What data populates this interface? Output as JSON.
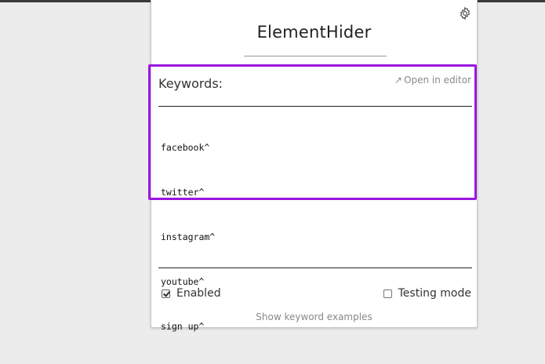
{
  "app": {
    "title": "ElementHider"
  },
  "icons": {
    "settings": "gear-icon",
    "open_editor": "arrow-up-right-icon"
  },
  "keywords": {
    "label": "Keywords:",
    "open_in_editor_label": "Open in editor",
    "lines": [
      "facebook^",
      "twitter^",
      "instagram^",
      "youtube^",
      "sign up^"
    ]
  },
  "options": {
    "enabled_label": "Enabled",
    "enabled_checked": true,
    "testing_label": "Testing mode",
    "testing_checked": false
  },
  "footer": {
    "examples_label": "Show keyword examples"
  },
  "colors": {
    "highlight": "#9b16e0"
  }
}
